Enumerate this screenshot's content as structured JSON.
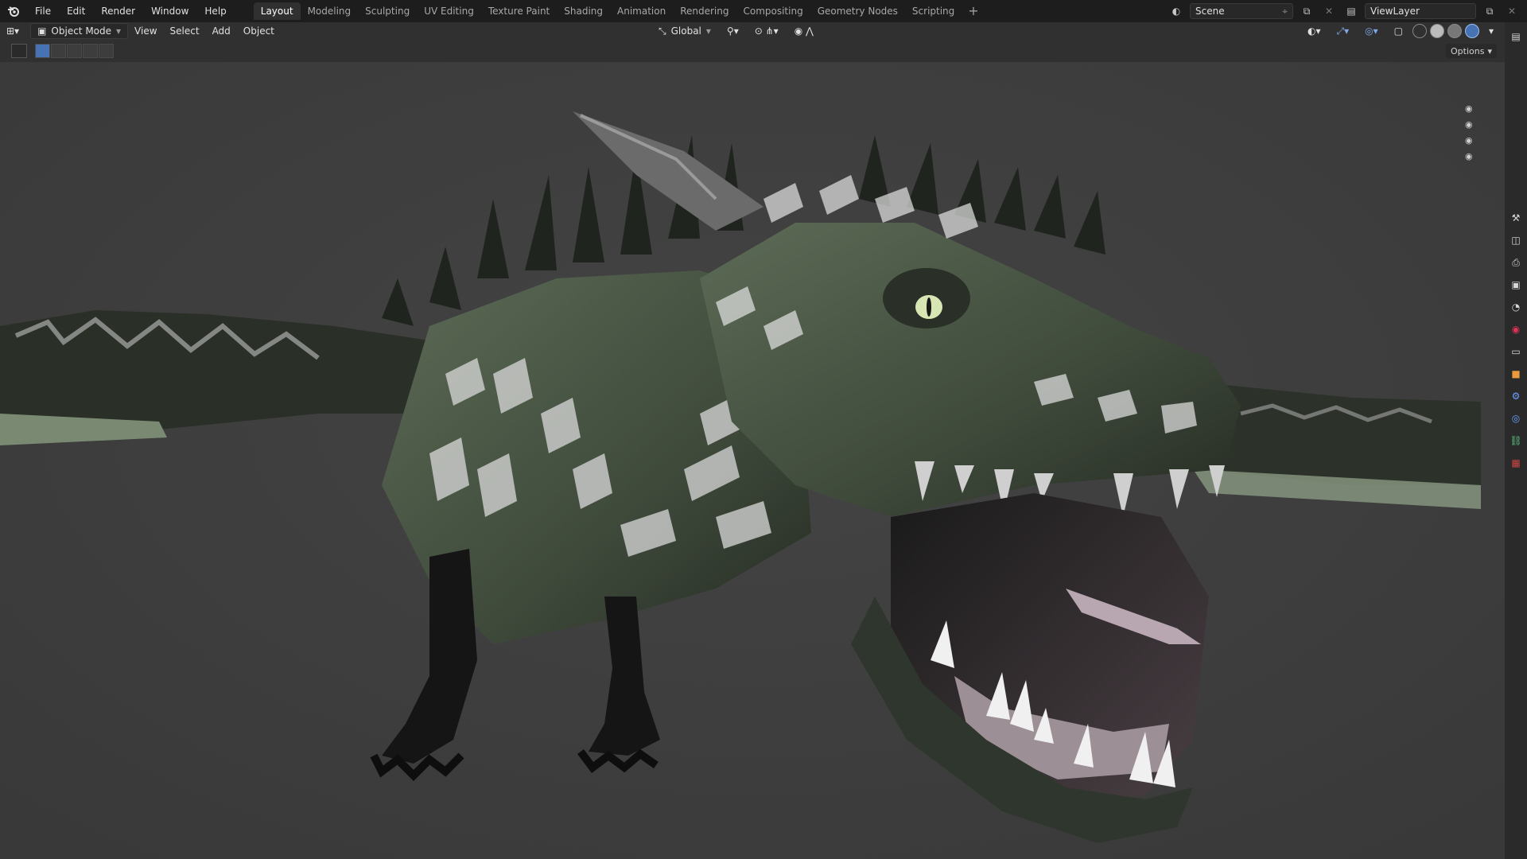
{
  "menu": [
    "File",
    "Edit",
    "Render",
    "Window",
    "Help"
  ],
  "workspaces": [
    "Layout",
    "Modeling",
    "Sculpting",
    "UV Editing",
    "Texture Paint",
    "Shading",
    "Animation",
    "Rendering",
    "Compositing",
    "Geometry Nodes",
    "Scripting"
  ],
  "active_workspace": "Layout",
  "scene_name": "Scene",
  "view_layer": "ViewLayer",
  "header": {
    "mode": "Object Mode",
    "view": "View",
    "select": "Select",
    "add": "Add",
    "object": "Object",
    "transform_orientation": "Global"
  },
  "tool_settings": {
    "options": "Options"
  },
  "colors": {
    "topbar": "#1d1d1d",
    "header": "#303030",
    "viewport": "#3d3d3d",
    "accent": "#4772b3",
    "dragon_green": "#4a5a44"
  },
  "icons": [
    "blender-logo-icon",
    "editor-type-icon",
    "object-mode-icon",
    "transform-orientation-icon",
    "pivot-icon",
    "snap-icon",
    "proportional-edit-icon",
    "visibility-icon",
    "gizmo-icon",
    "overlay-icon",
    "xray-icon",
    "wireframe-shading-icon",
    "solid-shading-icon",
    "material-shading-icon",
    "rendered-shading-icon",
    "camera-icon",
    "properties-icon"
  ]
}
